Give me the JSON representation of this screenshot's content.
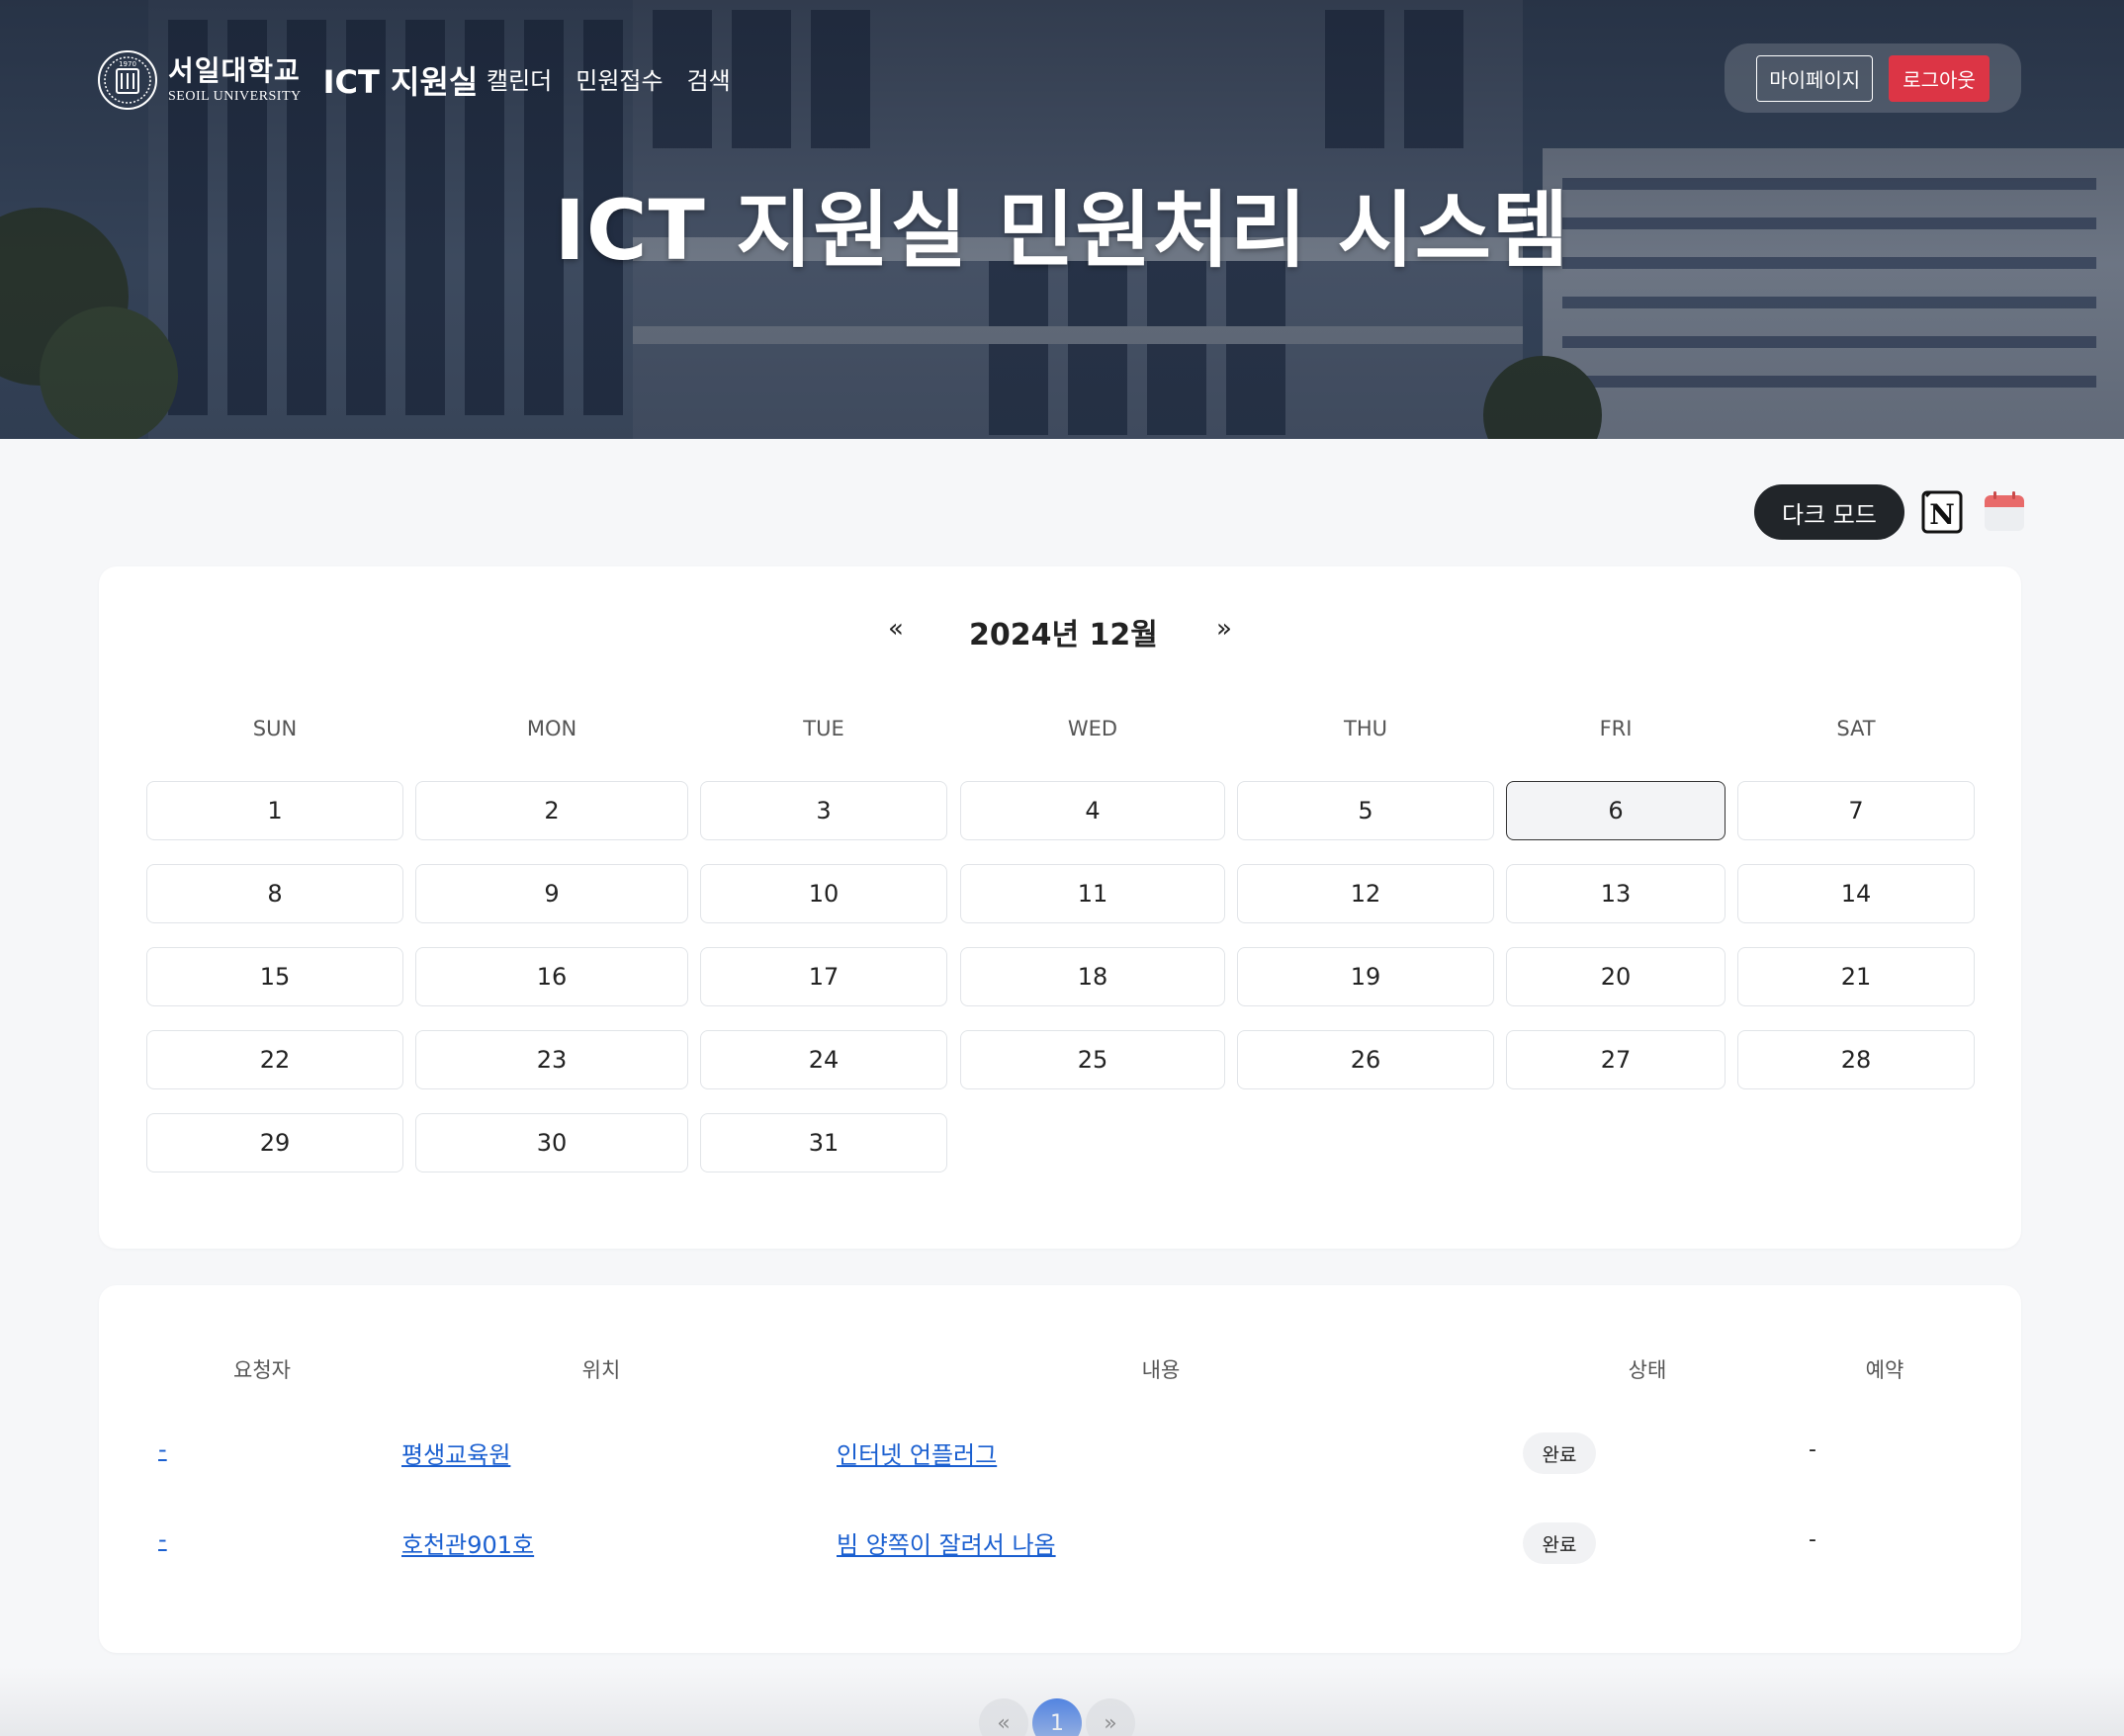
{
  "brand": {
    "university_ko": "서일대학교",
    "university_en": "SEOIL UNIVERSITY",
    "seal_text": "1970",
    "office": "ICT 지원실"
  },
  "nav": [
    "캘린더",
    "민원접수",
    "검색"
  ],
  "account": {
    "mypage": "마이페이지",
    "logout": "로그아웃"
  },
  "hero_title": "ICT 지원실 민원처리 시스템",
  "tools": {
    "dark_mode": "다크 모드",
    "notion_icon": "notion-icon",
    "calendar_icon": "calendar-icon"
  },
  "calendar": {
    "prev": "«",
    "next": "»",
    "title": "2024년 12월",
    "weekdays": [
      "SUN",
      "MON",
      "TUE",
      "WED",
      "THU",
      "FRI",
      "SAT"
    ],
    "days": [
      "1",
      "2",
      "3",
      "4",
      "5",
      "6",
      "7",
      "8",
      "9",
      "10",
      "11",
      "12",
      "13",
      "14",
      "15",
      "16",
      "17",
      "18",
      "19",
      "20",
      "21",
      "22",
      "23",
      "24",
      "25",
      "26",
      "27",
      "28",
      "29",
      "30",
      "31"
    ],
    "first_weekday": 0,
    "selected_day": "6"
  },
  "table": {
    "headers": [
      "요청자",
      "위치",
      "내용",
      "상태",
      "예약"
    ],
    "rows": [
      {
        "requester": "-",
        "location": "평생교육원",
        "content": "인터넷 언플러그",
        "status": "완료",
        "reservation": "-"
      },
      {
        "requester": "-",
        "location": "호천관901호",
        "content": "빔 양쪽이 잘려서 나옴",
        "status": "완료",
        "reservation": "-"
      }
    ]
  },
  "pagination": {
    "prev": "«",
    "current": "1",
    "next": "»"
  },
  "colors": {
    "accent": "#1f62e0",
    "logout": "#dc3545",
    "dark_button": "#212529",
    "link": "#1a5fd0"
  }
}
